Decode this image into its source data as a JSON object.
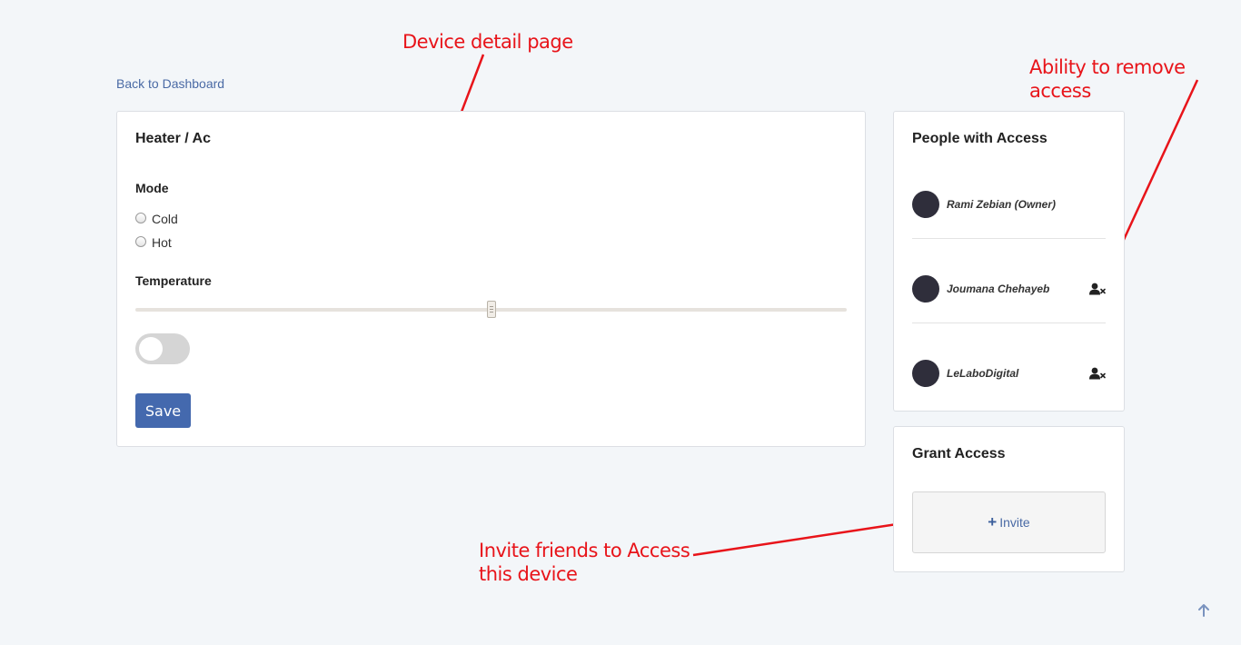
{
  "annotations": {
    "device_detail": "Device detail page",
    "remove_access": "Ability to remove access",
    "invite_line1": "Invite friends to Access",
    "invite_line2": "this device"
  },
  "nav": {
    "back_label": "Back to Dashboard"
  },
  "device": {
    "title": "Heater / Ac",
    "mode_label": "Mode",
    "mode_options": [
      "Cold",
      "Hot"
    ],
    "temperature_label": "Temperature",
    "temperature_level_fraction": 0.5,
    "toggle_on": false,
    "save_label": "Save"
  },
  "access": {
    "title": "People with Access",
    "people": [
      {
        "name": "Rami Zebian (Owner)",
        "removable": false,
        "icon": "remove-user-icon"
      },
      {
        "name": "Joumana Chehayeb",
        "removable": true,
        "icon": "remove-user-icon"
      },
      {
        "name": "LeLaboDigital",
        "removable": true,
        "icon": "remove-user-icon"
      }
    ]
  },
  "grant": {
    "title": "Grant Access",
    "invite_label": "Invite",
    "invite_icon": "plus-icon"
  },
  "colors": {
    "annotation": "#e8141a",
    "primary": "#4469ae",
    "link": "#4a6aa5",
    "avatar": "#2f2e3b",
    "background": "#f3f6f9"
  }
}
